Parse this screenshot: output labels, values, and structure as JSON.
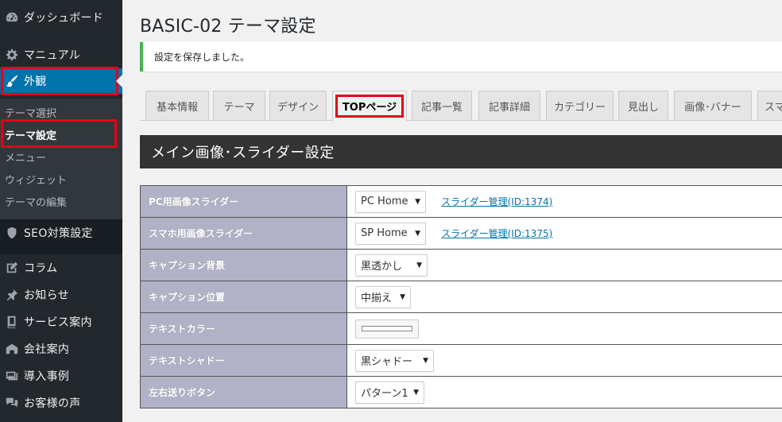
{
  "page": {
    "title": "BASIC-02 テーマ設定",
    "notice": "設定を保存しました。",
    "section_title": "メイン画像･スライダー設定"
  },
  "colors": {
    "sidebar_bg": "#23282d",
    "submenu_bg": "#32373c",
    "active_menu": "#0073aa",
    "highlight_red": "#e5001a",
    "notice_green": "#46b450",
    "table_header_bg": "#b1b1c8",
    "link": "#0073aa"
  },
  "sidebar": {
    "items": [
      {
        "label": "ダッシュボード",
        "icon": "dashboard-icon"
      },
      {
        "label": "マニュアル",
        "icon": "gear-icon"
      },
      {
        "label": "外観",
        "icon": "paintbrush-icon"
      },
      {
        "label": "SEO対策設定",
        "icon": "shield-icon"
      },
      {
        "label": "コラム",
        "icon": "edit-icon"
      },
      {
        "label": "お知らせ",
        "icon": "pushpin-icon"
      },
      {
        "label": "サービス案内",
        "icon": "book-icon"
      },
      {
        "label": "会社案内",
        "icon": "building-icon"
      },
      {
        "label": "導入事例",
        "icon": "gallery-icon"
      },
      {
        "label": "お客様の声",
        "icon": "comments-icon"
      }
    ],
    "submenu": [
      {
        "label": "テーマ選択"
      },
      {
        "label": "テーマ設定"
      },
      {
        "label": "メニュー"
      },
      {
        "label": "ウィジェット"
      },
      {
        "label": "テーマの編集"
      }
    ]
  },
  "tabs": [
    {
      "label": "基本情報"
    },
    {
      "label": "テーマ"
    },
    {
      "label": "デザイン"
    },
    {
      "label": "TOPページ"
    },
    {
      "label": "記事一覧"
    },
    {
      "label": "記事詳細"
    },
    {
      "label": "カテゴリー"
    },
    {
      "label": "見出し"
    },
    {
      "label": "画像･バナー"
    },
    {
      "label": "スマ"
    }
  ],
  "settings": [
    {
      "label": "PC用画像スライダー",
      "value": "PC Home",
      "link": "スライダー管理(ID:1374)"
    },
    {
      "label": "スマホ用画像スライダー",
      "value": "SP Home",
      "link": "スライダー管理(ID:1375)"
    },
    {
      "label": "キャプション背景",
      "value": "黒透かし"
    },
    {
      "label": "キャプション位置",
      "value": "中揃え"
    },
    {
      "label": "テキストカラー",
      "value": ""
    },
    {
      "label": "テキストシャドー",
      "value": "黒シャドー"
    },
    {
      "label": "左右送りボタン",
      "value": "パターン1"
    }
  ],
  "dropdown_arrow": "▼"
}
